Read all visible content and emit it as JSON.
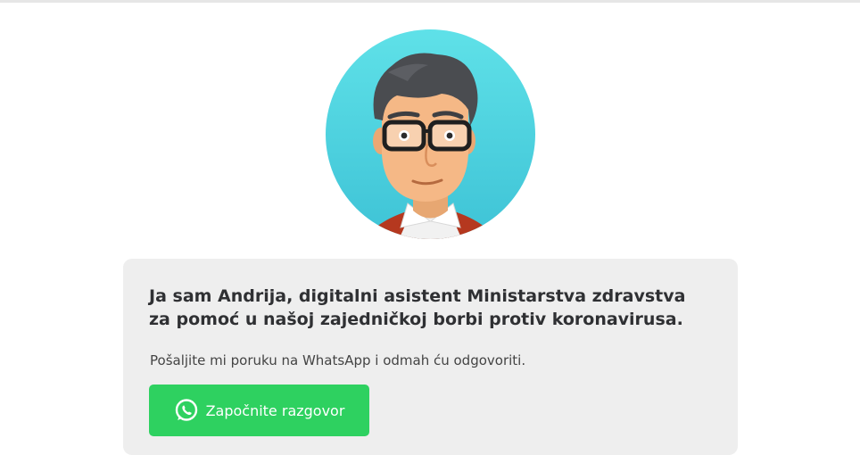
{
  "intro": {
    "heading": "Ja sam Andrija, digitalni asistent Ministarstva zdravstva za pomoć u našoj zajedničkoj borbi protiv koronavirusa.",
    "subtext": "Pošaljite mi poruku na WhatsApp i odmah ću odgovoriti.",
    "cta_label": "Započnite razgovor"
  },
  "colors": {
    "avatar_bg": "#4fd6e0",
    "card_bg": "#eeeeee",
    "button_bg": "#2ed160",
    "text": "#2f3033"
  },
  "icons": {
    "avatar": "cartoon-man-with-glasses",
    "cta": "whatsapp-icon"
  }
}
